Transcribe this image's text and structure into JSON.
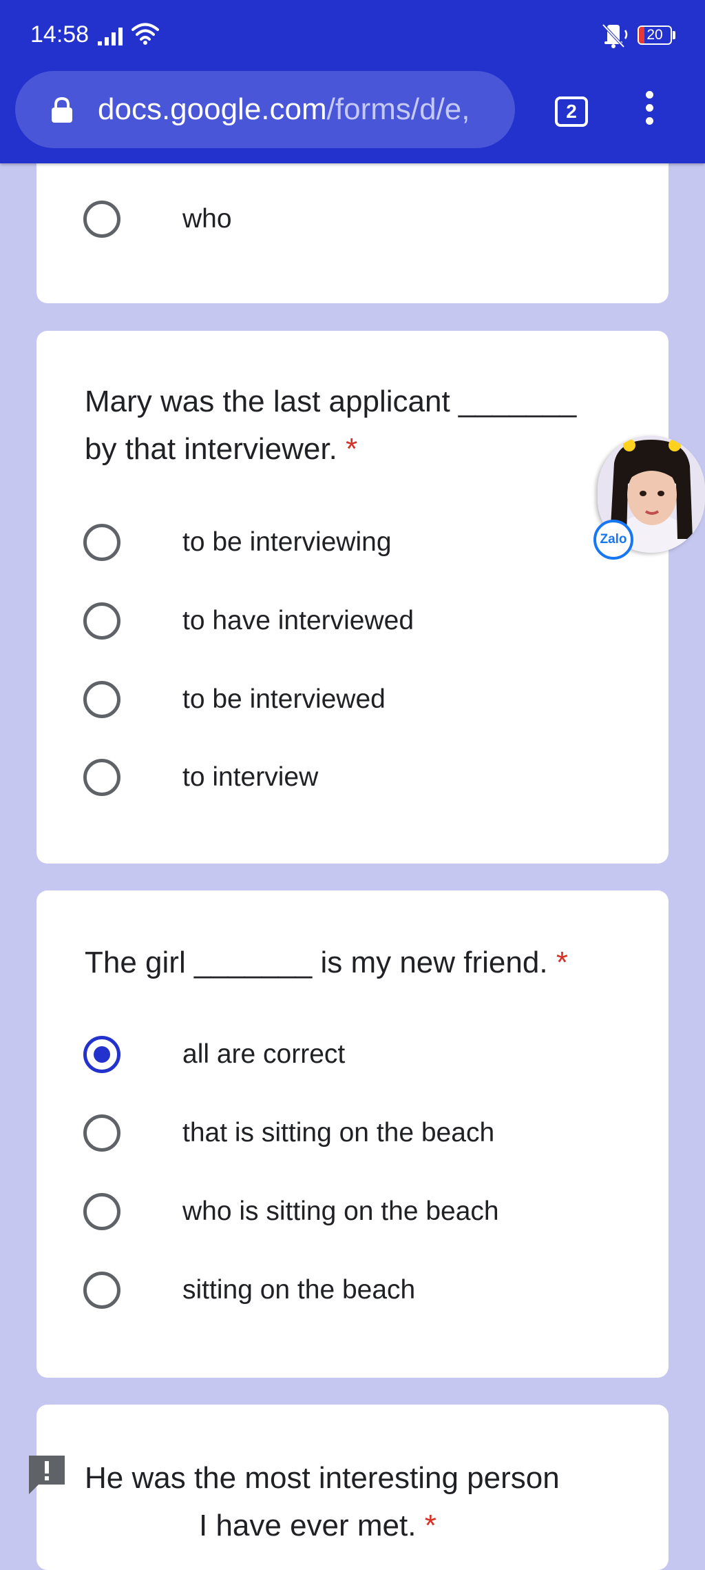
{
  "status_bar": {
    "time": "14:58",
    "battery": "20"
  },
  "browser": {
    "url_host": "docs.google.com",
    "url_path": "/forms/d/e,",
    "tab_count": "2"
  },
  "floating": {
    "app_badge": "Zalo"
  },
  "form": {
    "previous_question": {
      "options": [
        "who"
      ]
    },
    "questions": [
      {
        "text_line1": "Mary was the last applicant _______",
        "text_line2": "by that interviewer.",
        "required_mark": "*",
        "options": [
          "to be interviewing",
          "to have interviewed",
          "to be interviewed",
          "to interview"
        ],
        "selected": null
      },
      {
        "text": "The girl _______ is my new friend.",
        "required_mark": "*",
        "options": [
          "all are correct",
          "that is sitting on the beach",
          "who is sitting on the beach",
          "sitting on the beach"
        ],
        "selected": 0
      },
      {
        "text_line1": "He was the most interesting person",
        "text_line2": "I have ever met.",
        "required_mark": "*"
      }
    ]
  },
  "colors": {
    "toolbar": "#2331cd",
    "page_background": "#c5c7f1",
    "accent": "#2331cd",
    "required": "#d93025"
  }
}
